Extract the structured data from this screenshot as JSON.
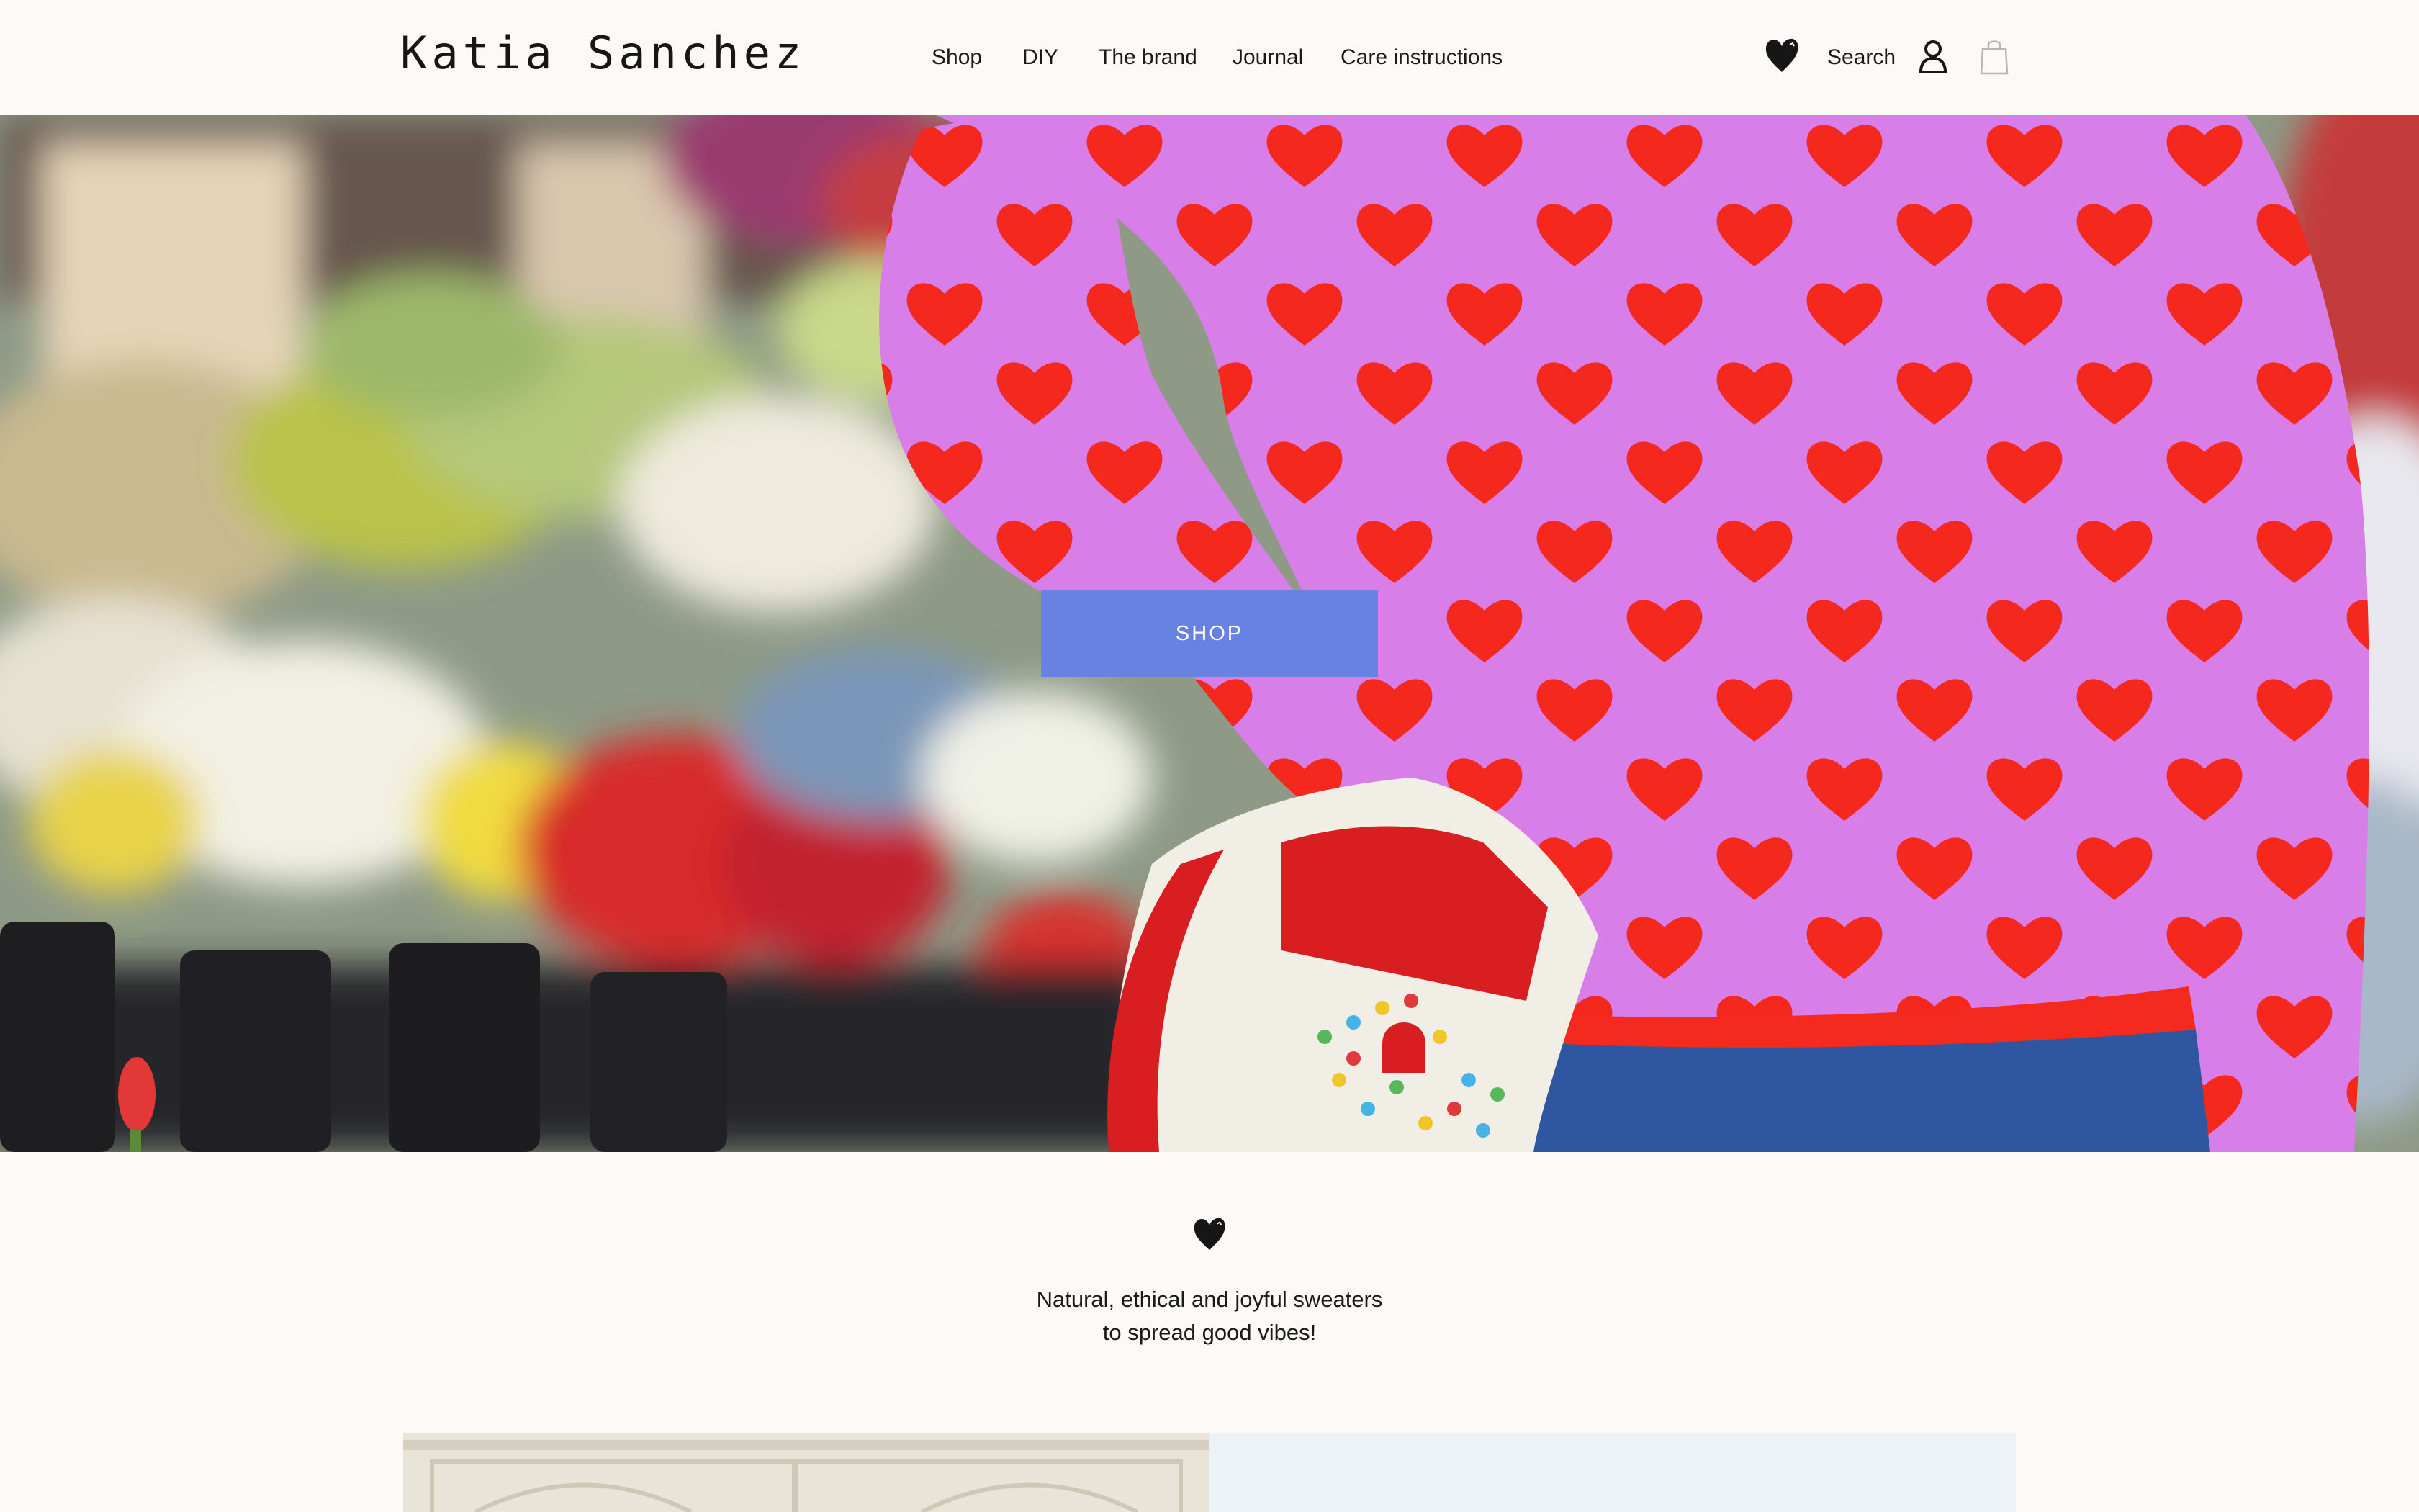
{
  "header": {
    "logo": "Katia Sanchez",
    "nav": [
      "Shop",
      "DIY",
      "The brand",
      "Journal",
      "Care instructions"
    ],
    "search_label": "Search",
    "icons": {
      "wishlist": "heart-icon",
      "account": "user-icon",
      "cart": "bag-icon"
    }
  },
  "hero": {
    "button_label": "SHOP",
    "button_color": "#6782e0"
  },
  "intro": {
    "icon": "heart-icon",
    "tagline_line1": "Natural, ethical and joyful sweaters",
    "tagline_line2": "to spread good vibes!"
  },
  "colors": {
    "background": "#fcf9f6",
    "sweater_pink": "#d77ee9",
    "sweater_red": "#f5281e"
  }
}
